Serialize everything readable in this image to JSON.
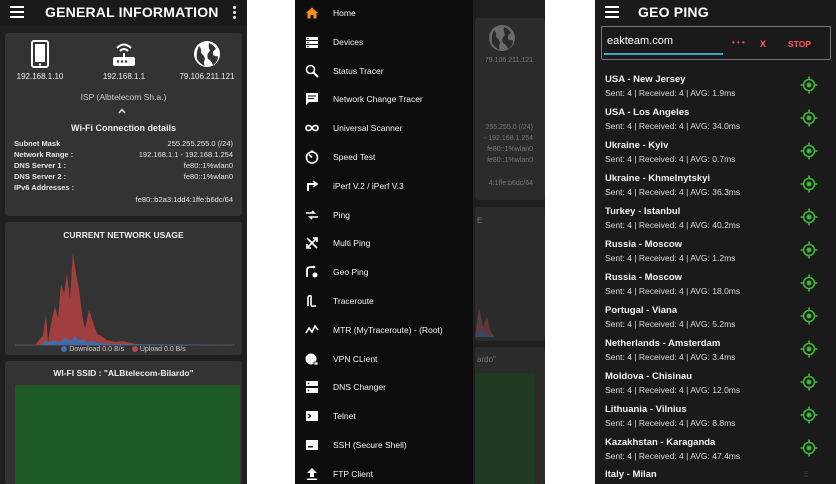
{
  "screen1": {
    "title": "GENERAL INFORMATION",
    "devices": [
      {
        "icon": "phone-icon",
        "label": "192.168.1.10"
      },
      {
        "icon": "router-icon",
        "label": "192.168.1.1"
      },
      {
        "icon": "globe-icon",
        "label": "79.106.211.121"
      }
    ],
    "isp": "ISP (Albtelecom Sh.a.)",
    "wifi_title": "Wi-Fi Connection details",
    "details": [
      {
        "key": "Subnet Mask",
        "value": "255.255.255.0 (/24)"
      },
      {
        "key": "Network Range :",
        "value": "192.168.1.1 - 192.168.1.254"
      },
      {
        "key": "DNS Server 1 :",
        "value": "fe80::1%wlan0"
      },
      {
        "key": "DNS Server 2 :",
        "value": "fe80::1%wlan0"
      },
      {
        "key": "IPv6 Addresses :",
        "value": ""
      }
    ],
    "ipv6": "fe80::b2a3:1dd4:1ffe:b6dc/64",
    "usage_title": "CURRENT NETWORK USAGE",
    "download_label": "Download 0.0  B/s",
    "upload_label": "Upload 0.0  B/s",
    "ssid_title": "WI-FI SSID :  \"ALBtelecom-Bilardo\"",
    "colors": {
      "download": "#3b6fb6",
      "upload": "#b04a4a",
      "ssid_area": "#1d5a25"
    }
  },
  "screen2": {
    "menu": [
      {
        "icon": "home-icon",
        "label": "Home"
      },
      {
        "icon": "devices-icon",
        "label": "Devices"
      },
      {
        "icon": "search-icon",
        "label": "Status Tracer"
      },
      {
        "icon": "message-icon",
        "label": "Network Change Tracer"
      },
      {
        "icon": "infinity-icon",
        "label": "Universal Scanner"
      },
      {
        "icon": "speedometer-icon",
        "label": "Speed Test"
      },
      {
        "icon": "iperf-icon",
        "label": "iPerf V.2 / iPerf V.3"
      },
      {
        "icon": "ping-icon",
        "label": "Ping"
      },
      {
        "icon": "multi-ping-icon",
        "label": "Multi Ping"
      },
      {
        "icon": "geo-icon",
        "label": "Geo Ping"
      },
      {
        "icon": "traceroute-icon",
        "label": "Traceroute"
      },
      {
        "icon": "mtr-icon",
        "label": "MTR (MyTraceroute) - (Root)"
      },
      {
        "icon": "vpn-icon",
        "label": "VPN CLient"
      },
      {
        "icon": "dns-icon",
        "label": "DNS Changer"
      },
      {
        "icon": "telnet-icon",
        "label": "Telnet"
      },
      {
        "icon": "ssh-icon",
        "label": "SSH (Secure Shell)"
      },
      {
        "icon": "upload-icon",
        "label": "FTP Client"
      }
    ],
    "peek": {
      "ip": "79.106.211.121",
      "lines": [
        "255.255.0 (/24)",
        "- 192.168.1.254",
        "fe80::1%wlan0",
        "fe80::1%wlan0",
        "4:1ffe:b6dc/64"
      ],
      "usage_fragment": "E",
      "ssid_fragment": "ardo\""
    },
    "accent": "#ff8c1a"
  },
  "screen3": {
    "title": "GEO PING",
    "search_value": "eakteam.com",
    "clear_label": "X",
    "stop_label": "STOP",
    "dots": "• • •",
    "pings": [
      {
        "location": "USA - New Jersey",
        "stats": "Sent: 4 | Received: 4 | AVG: 1.9ms"
      },
      {
        "location": "USA - Los Angeles",
        "stats": "Sent: 4 | Received: 4 | AVG: 34.0ms"
      },
      {
        "location": "Ukraine - Kyiv",
        "stats": "Sent: 4 | Received: 4 | AVG: 0.7ms"
      },
      {
        "location": "Ukraine - Khmelnytskyi",
        "stats": "Sent: 4 | Received: 4 | AVG: 36.3ms"
      },
      {
        "location": "Turkey - Istanbul",
        "stats": "Sent: 4 | Received: 4 | AVG: 40.2ms"
      },
      {
        "location": "Russia - Moscow",
        "stats": "Sent: 4 | Received: 4 | AVG: 1.2ms"
      },
      {
        "location": "Russia - Moscow",
        "stats": "Sent: 4 | Received: 4 | AVG: 18.0ms"
      },
      {
        "location": "Portugal - Viana",
        "stats": "Sent: 4 | Received: 4 | AVG: 5.2ms"
      },
      {
        "location": "Netherlands - Amsterdam",
        "stats": "Sent: 4 | Received: 4 | AVG: 3.4ms"
      },
      {
        "location": "Moldova - Chisinau",
        "stats": "Sent: 4 | Received: 4 | AVG: 12.0ms"
      },
      {
        "location": "Lithuania - Vilnius",
        "stats": "Sent: 4 | Received: 4 | AVG: 8.8ms"
      },
      {
        "location": "Kazakhstan - Karaganda",
        "stats": "Sent: 4 | Received: 4 | AVG: 47.4ms"
      },
      {
        "location": "Italy - Milan",
        "stats": ""
      }
    ],
    "colors": {
      "target": "#3fb83a",
      "action": "#ff5c5c",
      "input_line": "#3aa8c1"
    }
  }
}
